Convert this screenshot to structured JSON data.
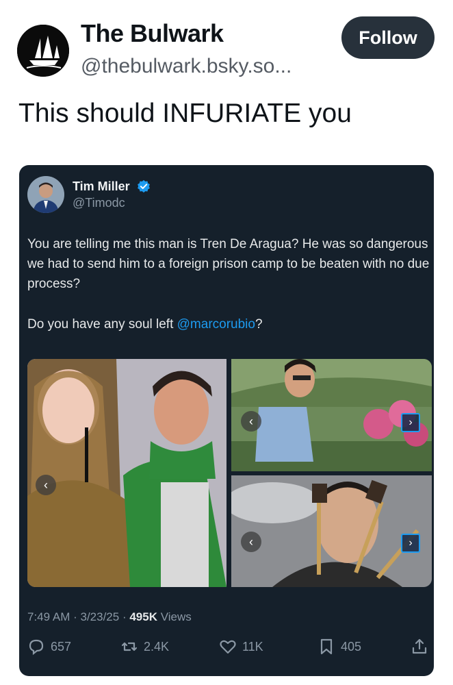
{
  "author": {
    "name": "The Bulwark",
    "handle": "@thebulwark.bsky.so...",
    "avatar_icon": "pirate-ship-icon"
  },
  "follow_label": "Follow",
  "post_text": "This should INFURIATE you",
  "quoted": {
    "name": "Tim Miller",
    "handle": "@Timodc",
    "text_para1": "You are telling me this man is Tren De Aragua? He was so dangerous we had to send him to a foreign prison camp to be beaten with no due process?",
    "text_para2_prefix": "Do you have any soul left ",
    "mention": "@marcorubio",
    "text_para2_suffix": "?",
    "time": "7:49 AM",
    "sep1": " · ",
    "date": "3/23/25",
    "sep2": " · ",
    "views_count": "495K",
    "views_label": " Views",
    "stats": {
      "replies": "657",
      "reposts": "2.4K",
      "likes": "11K",
      "bookmarks": "405"
    }
  },
  "colors": {
    "card_bg": "#15202b",
    "link": "#1d9bf0",
    "follow_bg": "#27313b"
  }
}
